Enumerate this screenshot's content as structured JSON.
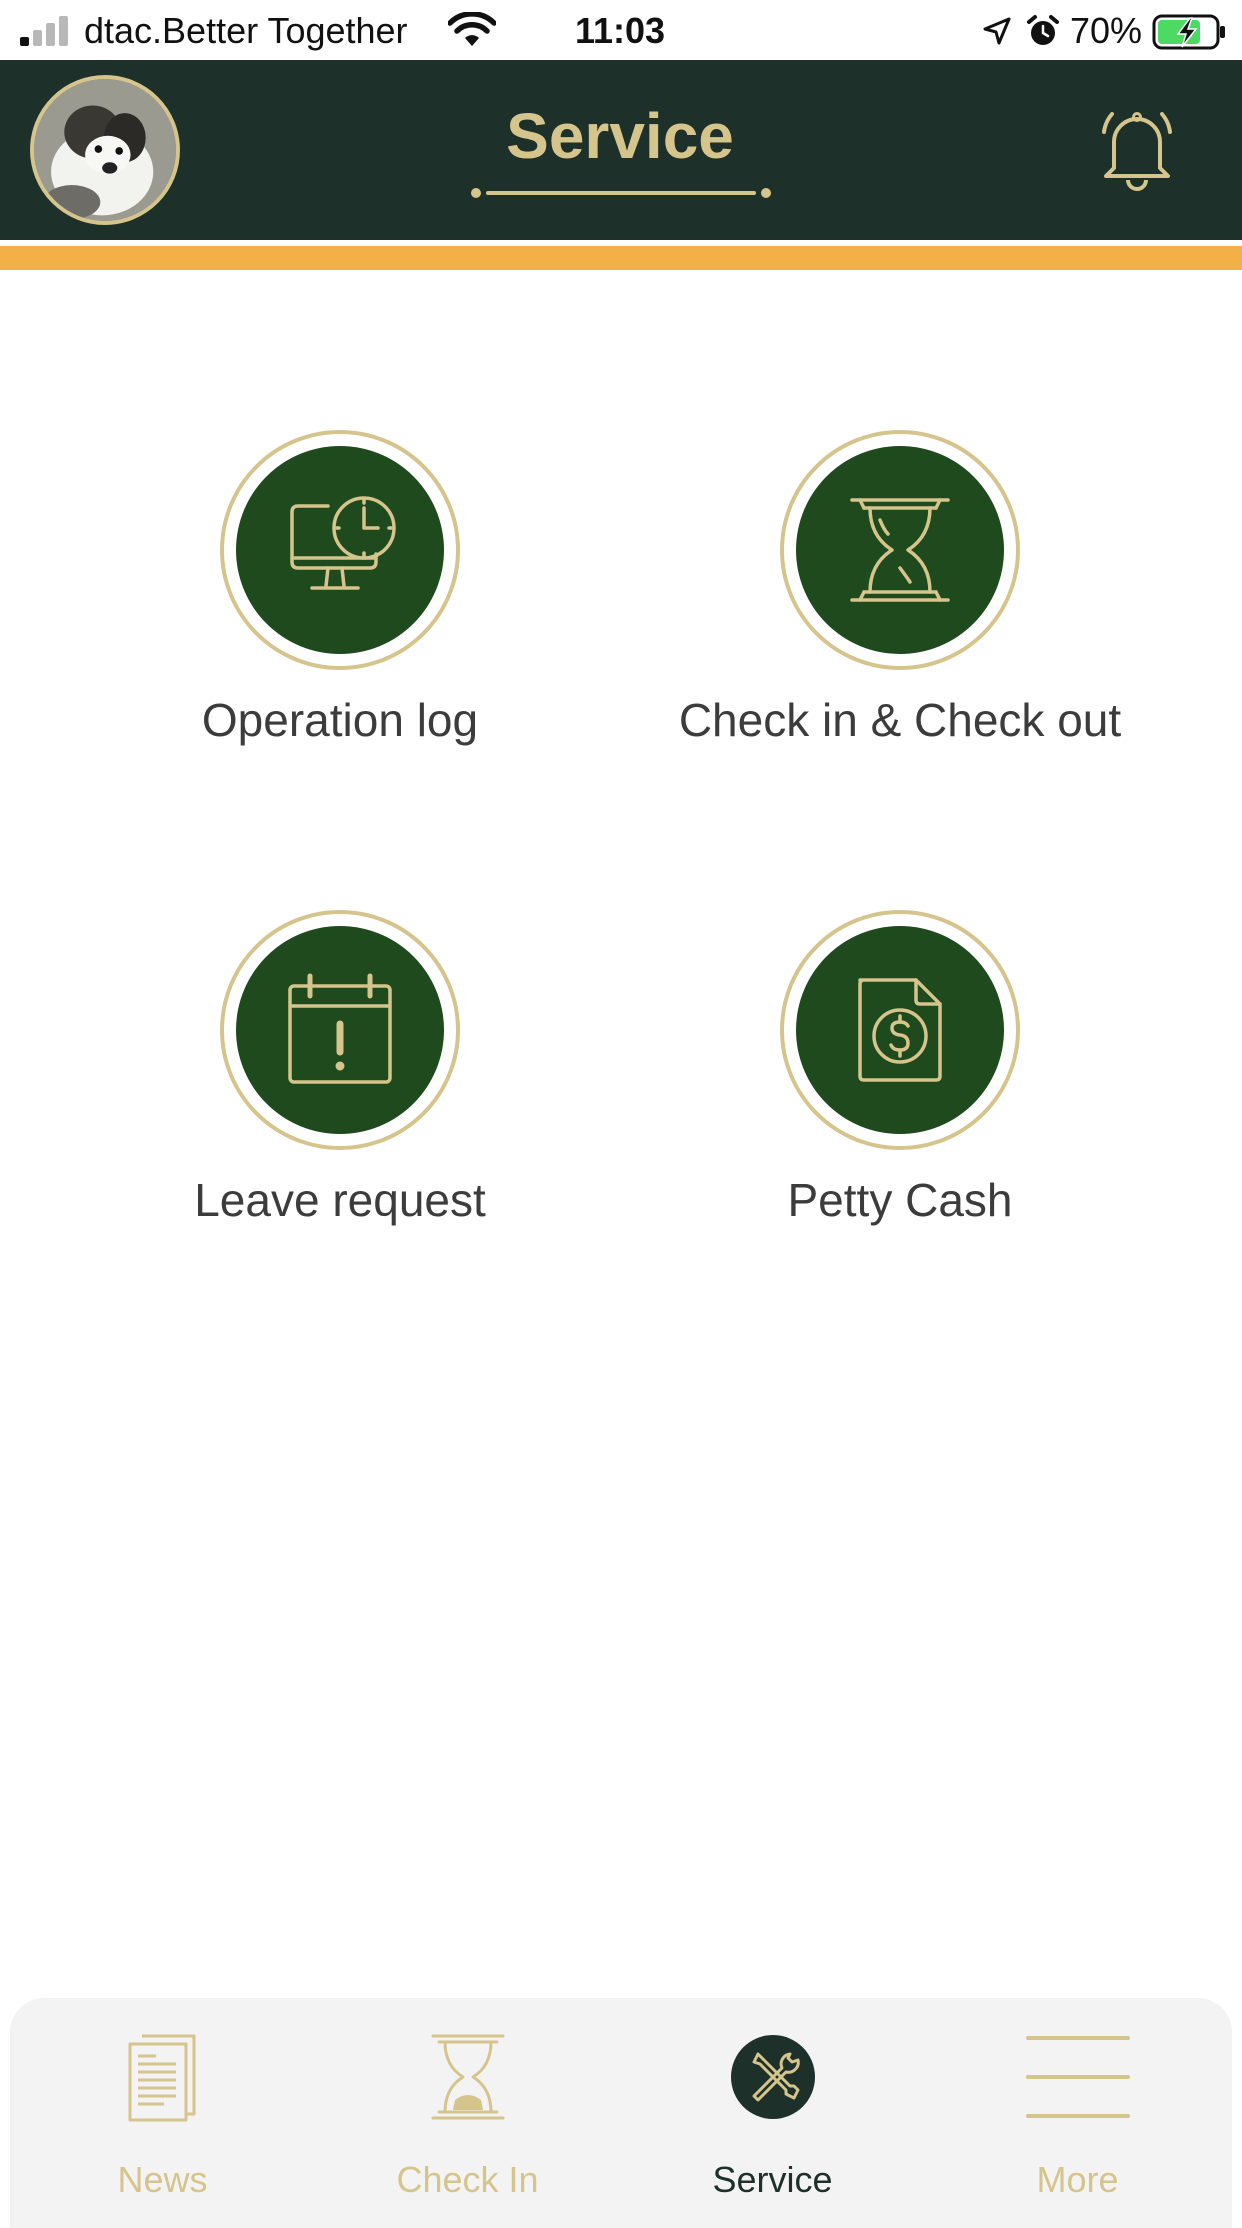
{
  "status_bar": {
    "carrier": "dtac.Better Together",
    "time": "11:03",
    "battery_percent": "70%"
  },
  "header": {
    "title": "Service"
  },
  "services": [
    {
      "label": "Operation log",
      "icon": "monitor-clock-icon"
    },
    {
      "label": "Check in & Check out",
      "icon": "hourglass-icon"
    },
    {
      "label": "Leave request",
      "icon": "calendar-alert-icon"
    },
    {
      "label": "Petty Cash",
      "icon": "document-dollar-icon"
    }
  ],
  "tabs": [
    {
      "label": "News",
      "icon": "newspaper-icon",
      "active": false
    },
    {
      "label": "Check In",
      "icon": "hourglass-icon",
      "active": false
    },
    {
      "label": "Service",
      "icon": "tools-icon",
      "active": true
    },
    {
      "label": "More",
      "icon": "menu-icon",
      "active": false
    }
  ],
  "colors": {
    "header_bg": "#1d3029",
    "accent_gold": "#d5c48c",
    "icon_disc": "#1e4a1e",
    "strip_orange": "#f3b046",
    "tab_bar_bg": "#f3f3f3"
  }
}
